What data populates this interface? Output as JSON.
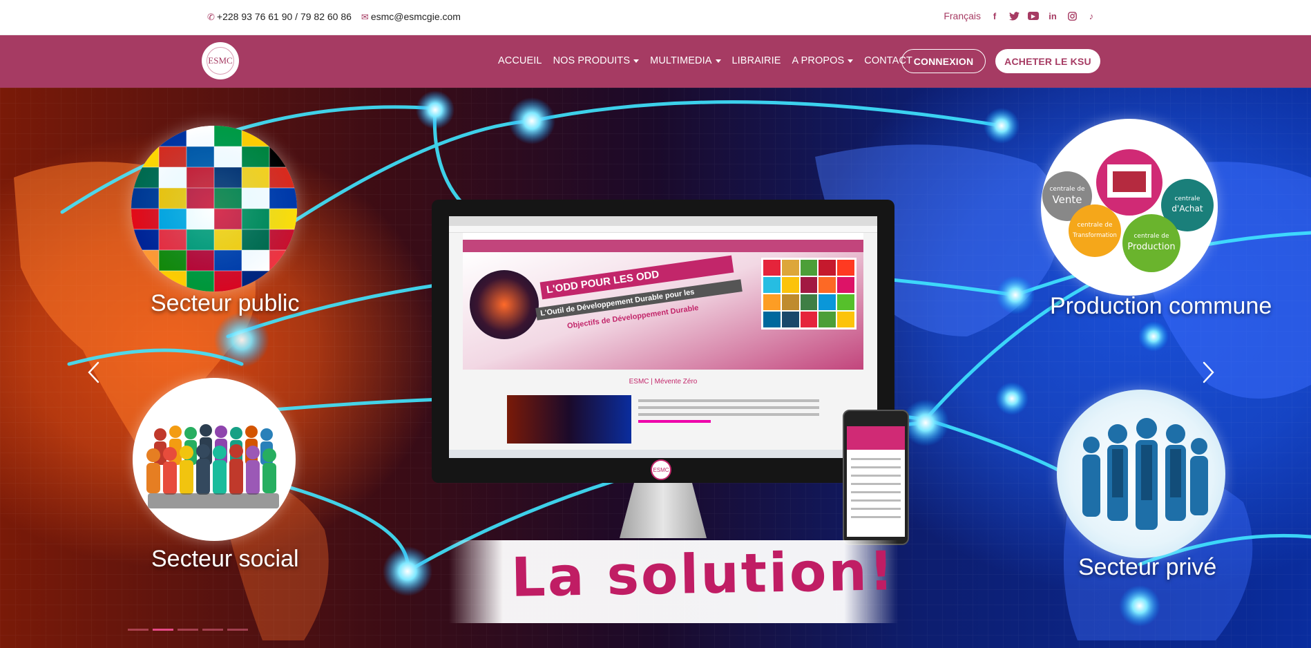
{
  "topbar": {
    "phone": "+228 93 76 61 90 / 79 82 60 86",
    "email": "esmc@esmcgie.com",
    "language": "Français",
    "social_icons": [
      "facebook-icon",
      "twitter-icon",
      "youtube-icon",
      "linkedin-icon",
      "instagram-icon",
      "tiktok-icon"
    ]
  },
  "navbar": {
    "logo_text": "ESMC",
    "menu": [
      {
        "label": "ACCUEIL",
        "dropdown": false
      },
      {
        "label": "NOS PRODUITS",
        "dropdown": true
      },
      {
        "label": "MULTIMEDIA",
        "dropdown": true
      },
      {
        "label": "LIBRAIRIE",
        "dropdown": false
      },
      {
        "label": "A PROPOS",
        "dropdown": true
      },
      {
        "label": "CONTACT",
        "dropdown": false
      }
    ],
    "login_label": "CONNEXION",
    "buy_label": "ACHETER LE KSU"
  },
  "hero": {
    "labels": {
      "public": "Secteur public",
      "social": "Secteur social",
      "production": "Production commune",
      "private": "Secteur privé"
    },
    "production_circles": [
      "centrale de Vente",
      "centrale d'Achat",
      "centrale de Transformation",
      "centrale de Production"
    ],
    "screen": {
      "banner_line1": "L'ODD POUR LES ODD",
      "banner_line2": "L'Outil de Développement Durable pour les",
      "banner_line3": "Objectifs de Développement Durable",
      "section_title": "ESMC | Mévente Zéro",
      "logo_text": "ESMC"
    },
    "tagline": "La solution!",
    "slides_total": 5,
    "active_slide": 2,
    "colors": {
      "brand": "#a63b63",
      "accent": "#c01d64"
    }
  }
}
